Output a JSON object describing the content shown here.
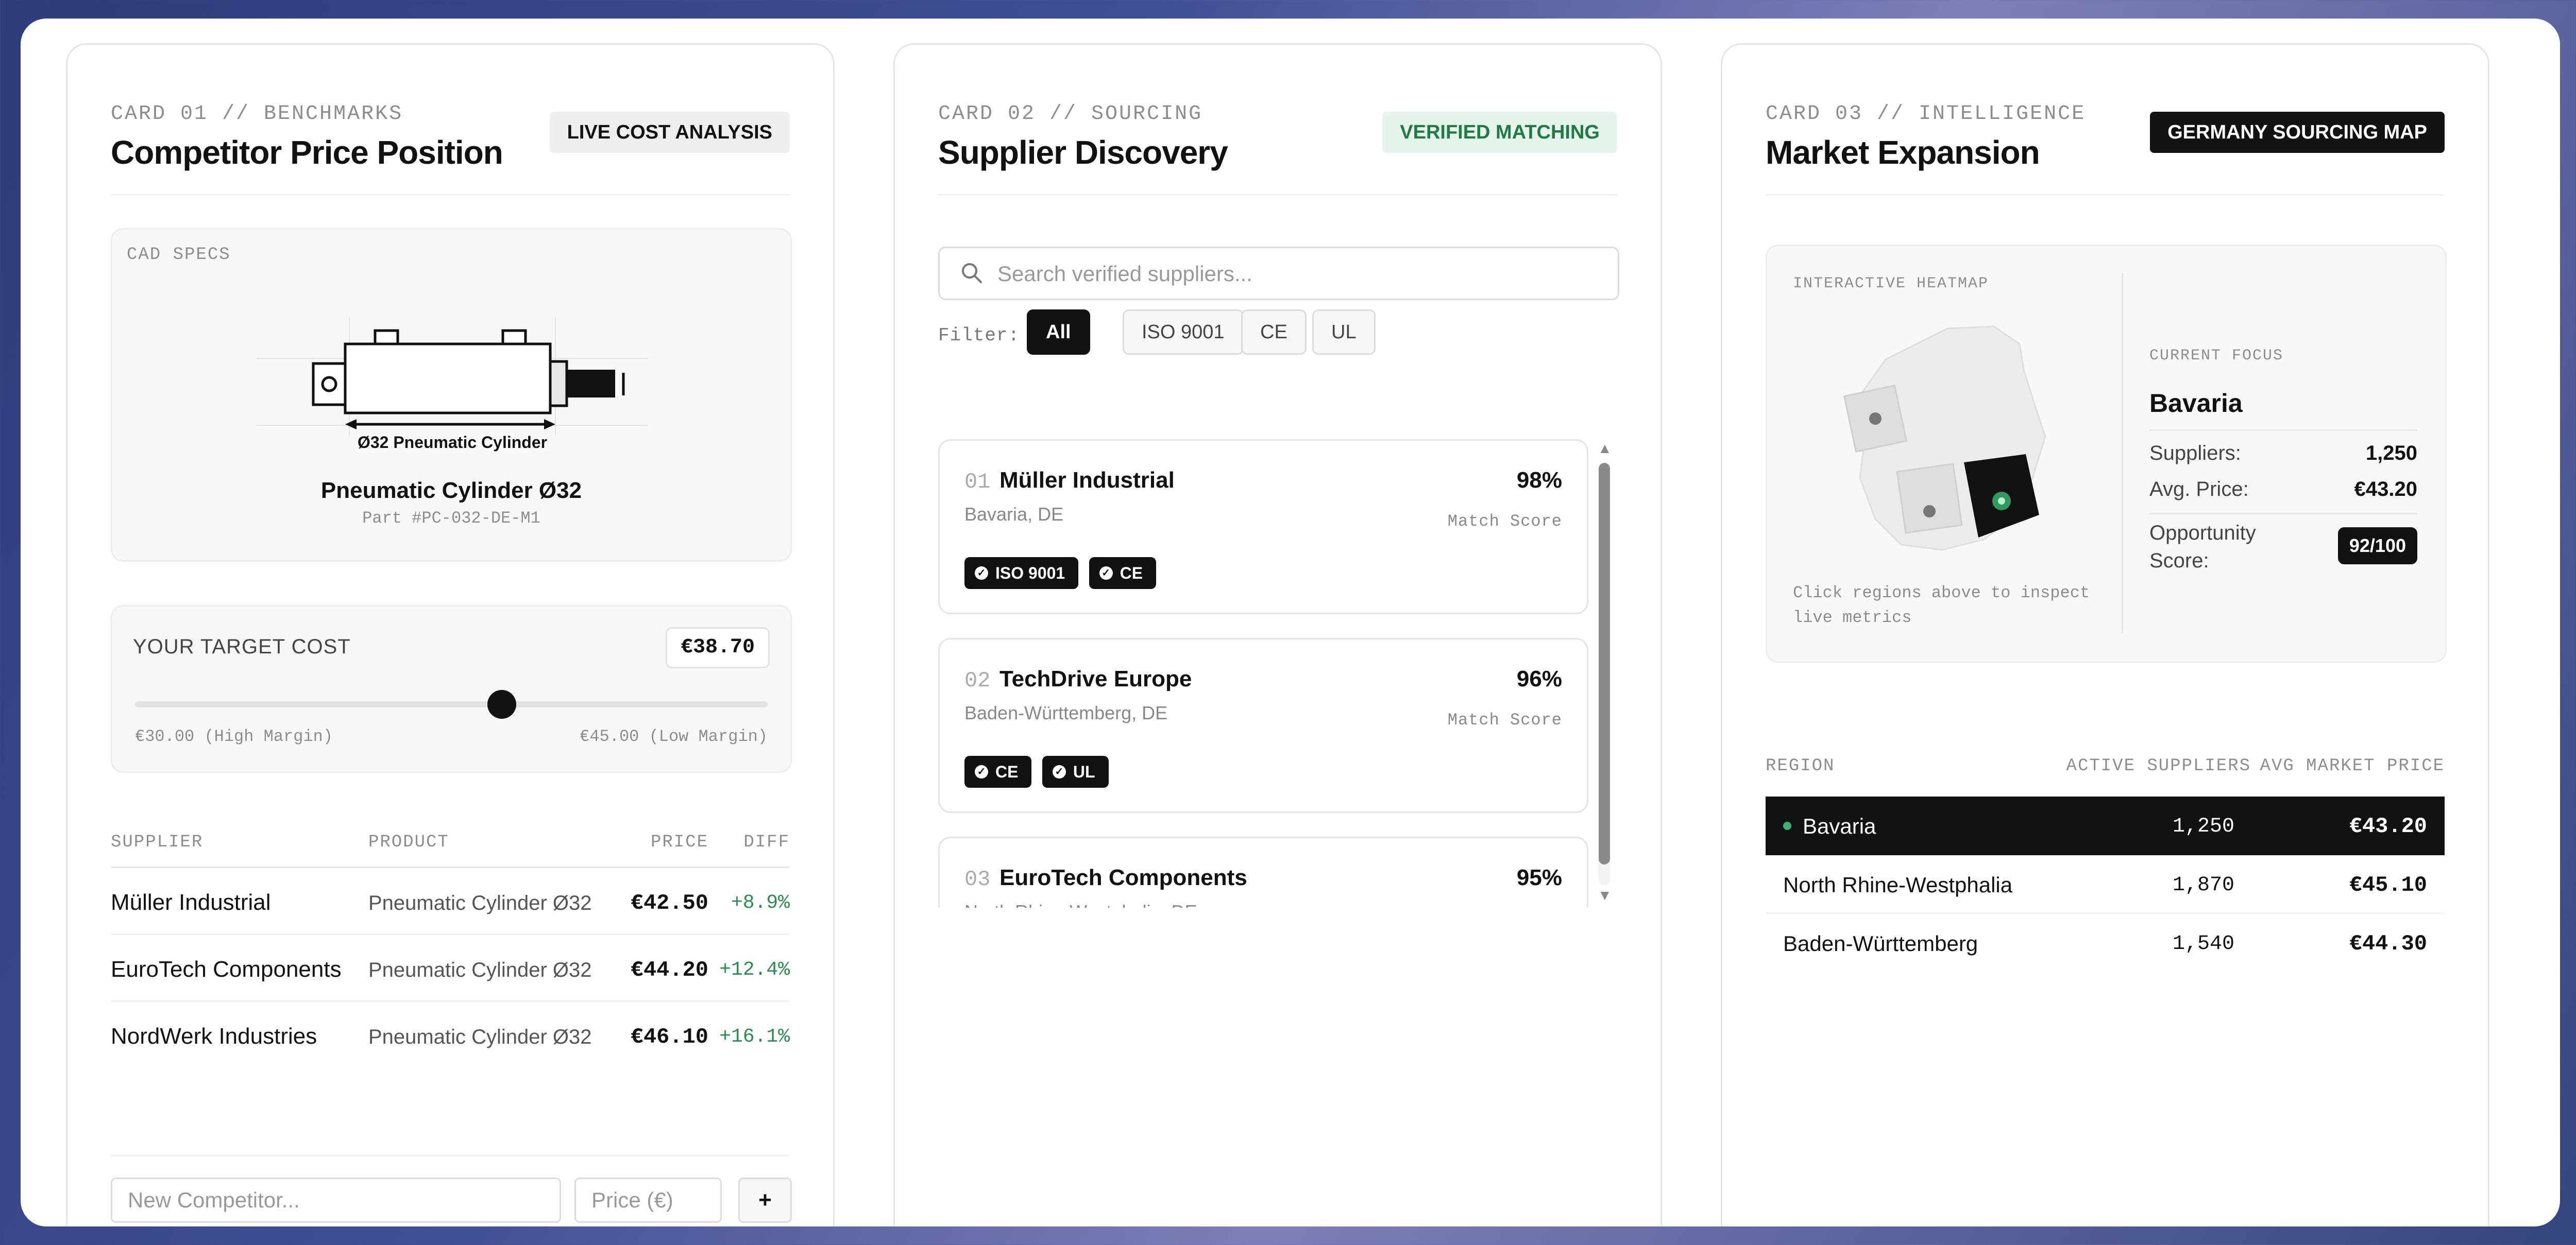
{
  "card1": {
    "kicker": "CARD 01 // BENCHMARKS",
    "title": "Competitor Price Position",
    "badge": "LIVE COST ANALYSIS",
    "cad_label": "CAD SPECS",
    "cad_dimension": "Ø32 Pneumatic Cylinder",
    "product_name": "Pneumatic Cylinder Ø32",
    "part_number": "Part #PC-032-DE-M1",
    "target_label": "YOUR TARGET COST",
    "target_value": "€38.70",
    "target_fraction": 0.58,
    "min_label": "€30.00 (High Margin)",
    "max_label": "€45.00 (Low Margin)",
    "table": {
      "headers": {
        "supplier": "SUPPLIER",
        "product": "PRODUCT",
        "price": "PRICE",
        "diff": "DIFF"
      },
      "rows": [
        {
          "supplier": "Müller Industrial",
          "product": "Pneumatic Cylinder Ø32",
          "price": "€42.50",
          "diff": "+8.9%"
        },
        {
          "supplier": "EuroTech Components",
          "product": "Pneumatic Cylinder Ø32",
          "price": "€44.20",
          "diff": "+12.4%"
        },
        {
          "supplier": "NordWerk Industries",
          "product": "Pneumatic Cylinder Ø32",
          "price": "€46.10",
          "diff": "+16.1%"
        }
      ]
    },
    "new_competitor_placeholder": "New Competitor...",
    "price_placeholder": "Price (€)",
    "add_label": "+"
  },
  "card2": {
    "kicker": "CARD 02 // SOURCING",
    "title": "Supplier Discovery",
    "badge": "VERIFIED MATCHING",
    "search_placeholder": "Search verified suppliers...",
    "filter_label": "Filter:",
    "filters": [
      "All",
      "ISO 9001",
      "CE",
      "UL"
    ],
    "match_label": "Match Score",
    "suppliers": [
      {
        "num": "01",
        "name": "Müller Industrial",
        "location": "Bavaria, DE",
        "score": "98%",
        "tags": [
          "ISO 9001",
          "CE"
        ]
      },
      {
        "num": "02",
        "name": "TechDrive Europe",
        "location": "Baden-Württemberg, DE",
        "score": "96%",
        "tags": [
          "CE",
          "UL"
        ]
      },
      {
        "num": "03",
        "name": "EuroTech Components",
        "location": "North Rhine-Westphalia, DE",
        "score": "95%",
        "tags": []
      }
    ]
  },
  "card3": {
    "kicker": "CARD 03 // INTELLIGENCE",
    "title": "Market Expansion",
    "badge": "GERMANY SOURCING MAP",
    "heatmap_label": "INTERACTIVE HEATMAP",
    "heatmap_hint": "Click regions above to inspect live metrics",
    "focus_label": "CURRENT FOCUS",
    "focus_region": "Bavaria",
    "suppliers_label": "Suppliers:",
    "suppliers_value": "1,250",
    "avg_price_label": "Avg. Price:",
    "avg_price_value": "€43.20",
    "opportunity_label": "Opportunity Score:",
    "opportunity_value": "92/100",
    "table": {
      "headers": {
        "region": "REGION",
        "active": "ACTIVE SUPPLIERS",
        "avg": "AVG MARKET PRICE"
      },
      "rows": [
        {
          "region": "Bavaria",
          "active": "1,250",
          "avg": "€43.20"
        },
        {
          "region": "North Rhine-Westphalia",
          "active": "1,870",
          "avg": "€45.10"
        },
        {
          "region": "Baden-Württemberg",
          "active": "1,540",
          "avg": "€44.30"
        }
      ]
    }
  },
  "colors": {
    "accent_green": "#2e8b4e",
    "badge_green_bg": "#e6f5ec",
    "dark": "#111111"
  }
}
